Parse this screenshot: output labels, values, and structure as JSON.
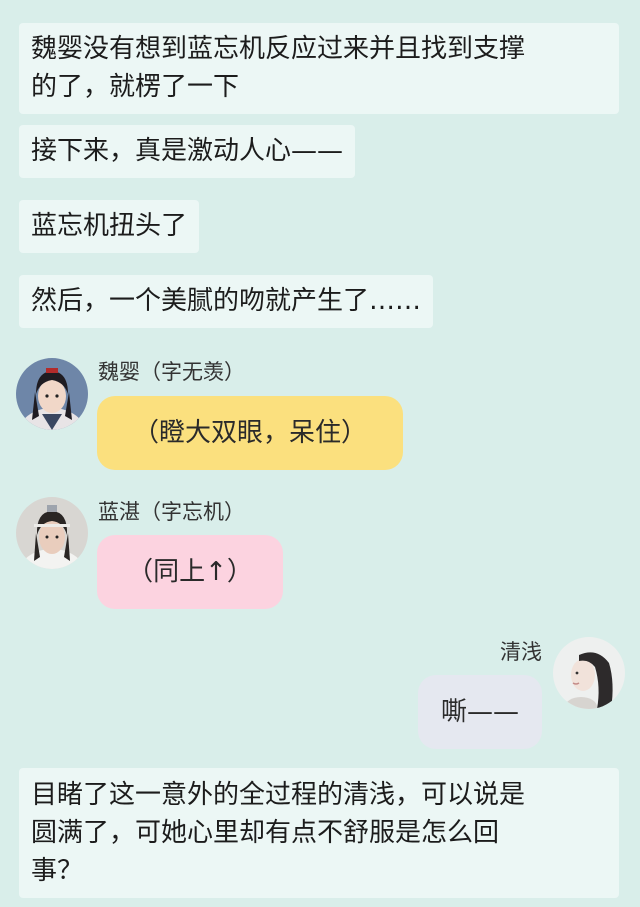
{
  "narrations": [
    {
      "line1": "魏婴没有想到蓝忘机反应过来并且找到支撑",
      "line2": "的了，就楞了一下"
    },
    {
      "line1": "接下来，真是激动人心——"
    },
    {
      "line1": "蓝忘机扭头了"
    },
    {
      "line1": "然后，一个美腻的吻就产生了……"
    },
    {
      "line1": "目睹了这一意外的全过程的清浅，可以说是",
      "line2": "圆满了，可她心里却有点不舒服是怎么回",
      "line3": "事？"
    }
  ],
  "messages": [
    {
      "name": "魏婴（字无羡）",
      "text": "（瞪大双眼，呆住）",
      "bubble_color": "#fbe07e",
      "avatar": "wei-ying-avatar"
    },
    {
      "name": "蓝湛（字忘机）",
      "text": "（同上↑）",
      "bubble_color": "#fcd3e0",
      "avatar": "lan-zhan-avatar"
    },
    {
      "name": "清浅",
      "text": "嘶——",
      "bubble_color": "#e5e8f0",
      "avatar": "qing-qian-avatar"
    }
  ],
  "colors": {
    "background": "#d9eeea",
    "narration_bg": "#ecf7f5"
  }
}
